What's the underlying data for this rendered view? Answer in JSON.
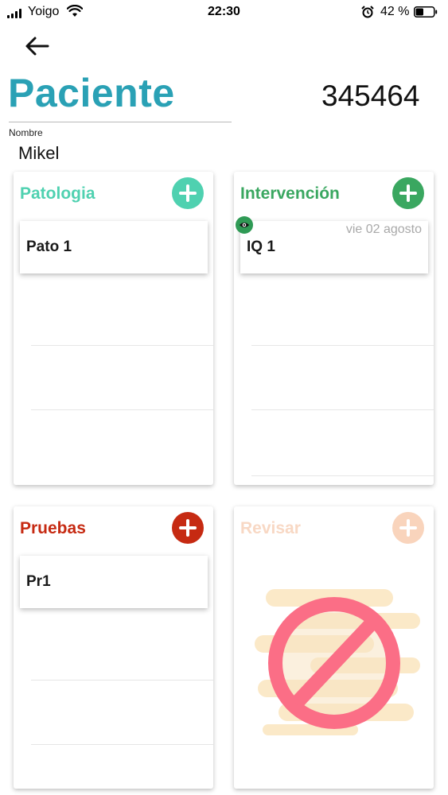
{
  "status_bar": {
    "carrier": "Yoigo",
    "time": "22:30",
    "battery_text": "42 %",
    "battery_level": 0.42,
    "icons": [
      "signal-icon",
      "wifi-icon",
      "alarm-icon",
      "battery-icon"
    ]
  },
  "header": {
    "back_icon": "arrow-left-icon",
    "title": "Paciente",
    "patient_id": "345464",
    "name_label": "Nombre",
    "name_value": "Mikel"
  },
  "panels": [
    {
      "title": "Patologia",
      "title_color": "#4fd1b0",
      "button_color": "#4fd1b0",
      "button_icon": "plus-icon",
      "items": [
        {
          "label": "Pato 1",
          "date": ""
        }
      ]
    },
    {
      "title": "Intervención",
      "title_color": "#3aa760",
      "button_color": "#3aa760",
      "button_icon": "plus-icon",
      "items": [
        {
          "label": "IQ 1",
          "date": "vie 02 agosto",
          "badge_icon": "eye-icon"
        }
      ]
    },
    {
      "title": "Pruebas",
      "title_color": "#c62a12",
      "button_color": "#c62a12",
      "button_icon": "plus-icon",
      "items": [
        {
          "label": "Pr1",
          "date": ""
        }
      ]
    },
    {
      "title": "Revisar",
      "title_color": "#f8d8c4",
      "button_color": "#f9d4bc",
      "button_icon": "plus-icon",
      "empty_state_icon": "forbidden-icon",
      "items": []
    }
  ]
}
